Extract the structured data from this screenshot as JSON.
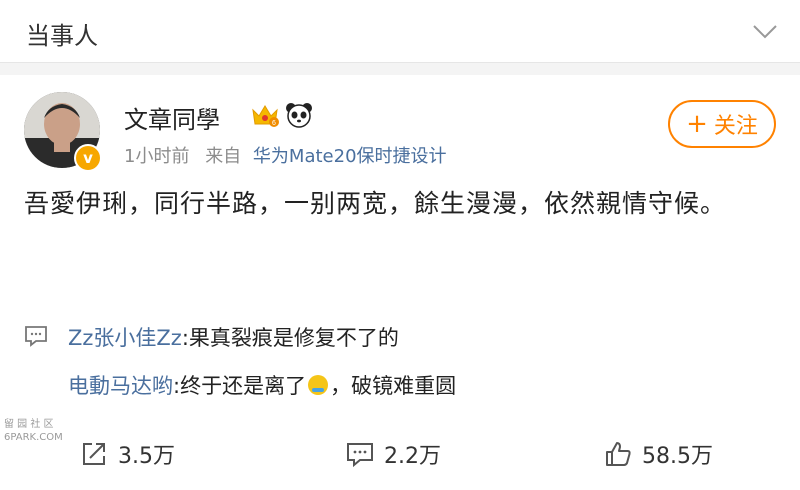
{
  "header": {
    "title": "当事人"
  },
  "post": {
    "username": "文章同學",
    "verified_badge": "v",
    "time": "1小时前",
    "source_prefix": "来自",
    "source": "华为Mate20保时捷设计",
    "follow_label": "关注",
    "follow_plus": "+",
    "content": "吾愛伊琍，同行半路，一别两宽，餘生漫漫，依然親情守候。"
  },
  "comments": [
    {
      "name": "Zz张小佳Zz",
      "text": ":果真裂痕是修复不了的"
    },
    {
      "name": "电動马达哟",
      "text_before": ":终于还是离了",
      "text_after": "，破镜难重圆"
    }
  ],
  "watermark": {
    "line1": "留 园 社 区",
    "line2": "6PARK.COM"
  },
  "actions": {
    "repost_count": "3.5万",
    "comment_count": "2.2万",
    "like_count": "58.5万"
  },
  "colors": {
    "accent": "#ff8200",
    "link": "#4a6f9e",
    "meta": "#8c8c8c"
  },
  "icons": [
    "chevron-down-icon",
    "crown-icon",
    "panda-icon",
    "comment-icon",
    "repost-icon",
    "like-icon"
  ]
}
